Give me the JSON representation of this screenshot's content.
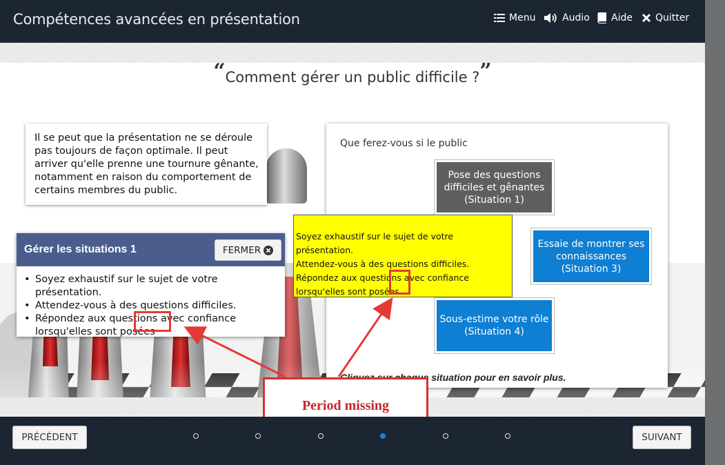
{
  "header": {
    "title": "Compétences avancées en présentation",
    "nav": [
      {
        "label": "Menu",
        "icon": "menu-list-icon"
      },
      {
        "label": "Audio",
        "icon": "speaker-icon"
      },
      {
        "label": "Aide",
        "icon": "book-icon"
      },
      {
        "label": "Quitter",
        "icon": "close-x-icon"
      }
    ]
  },
  "slide": {
    "question": "Comment gérer un public difficile ?",
    "intro_text": "Il se peut que la présentation ne se déroule pas toujours de façon optimale. Il peut arriver qu'elle prenne une tournure gênante, notamment en raison du comportement de certains membres du public.",
    "panel": {
      "title": "Gérer les situations 1",
      "close_label": "FERMER",
      "bullets": [
        "Soyez exhaustif sur le sujet de votre présentation.",
        "Attendez-vous à des questions difficiles.",
        "Répondez aux questions avec confiance lorsqu'elles sont posées"
      ]
    },
    "right": {
      "prompt": "Que ferez-vous si le public",
      "situations": [
        {
          "label": "Pose des questions difficiles et gênantes (Situation 1)",
          "color": "#5f5f5f"
        },
        {
          "label": "Essaie de montrer ses connaissances (Situation 3)",
          "color": "#0e7fd2"
        },
        {
          "label": "Sous-estime votre rôle (Situation 4)",
          "color": "#0e7fd2"
        }
      ],
      "instruction": "Cliquez sur chaque situation pour en savoir plus."
    }
  },
  "annotation": {
    "yellow_lines": [
      "Soyez exhaustif sur le sujet de votre présentation.",
      "Attendez-vous à des questions difficiles.",
      "Répondez aux questions avec confiance",
      "lorsqu'elles sont posées."
    ],
    "callout": "Period missing"
  },
  "footer": {
    "prev_label": "PRÉCÉDENT",
    "next_label": "SUIVANT",
    "pages": 6,
    "current_page": 4
  },
  "colors": {
    "bar": "#1c2633",
    "panel_header": "#4a5d8c",
    "accent_blue": "#0e7fd2",
    "annotation_red": "#e53935",
    "highlight_yellow": "#ffff00"
  }
}
